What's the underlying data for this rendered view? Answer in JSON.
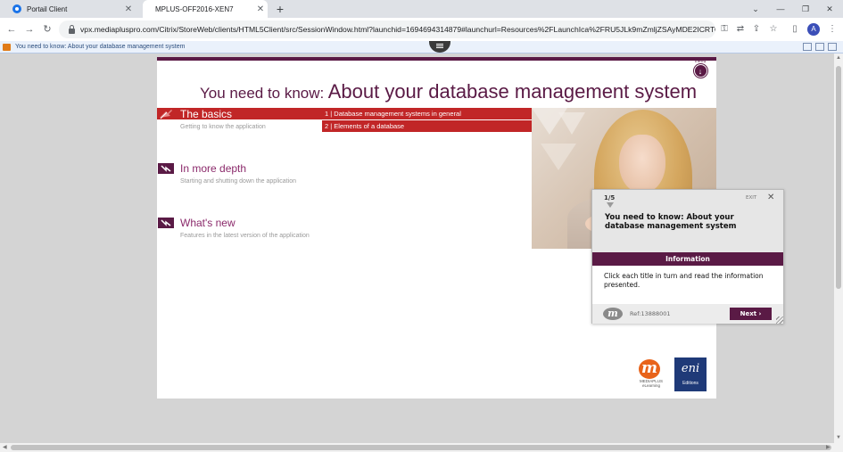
{
  "browser": {
    "tabs": [
      {
        "title": "Portail Client",
        "active": false
      },
      {
        "title": "MPLUS-OFF2016-XEN7",
        "active": true
      }
    ],
    "url": "vpx.mediapluspro.com/Citrix/StoreWeb/clients/HTML5Client/src/SessionWindow.html?launchid=1694694314879#launchurl=Resources%2FLaunchIca%2FRU5JLk9mZmljZSAyMDE2ICRTO...",
    "avatar_letter": "A",
    "icons": [
      "back-icon",
      "forward-icon",
      "reload-icon",
      "lock-icon",
      "key-icon",
      "translate-icon",
      "share-icon",
      "star-icon",
      "side-panel-icon",
      "more-icon"
    ]
  },
  "infobar": {
    "text": "You need to know: About your database management system"
  },
  "slide": {
    "menu_label": "menu",
    "title_prefix": "You need to know:",
    "title_main": "About your database management system",
    "sections": [
      {
        "title": "The basics",
        "subtitle": "Getting to know the application",
        "active": true
      },
      {
        "title": "In more depth",
        "subtitle": "Starting and shutting down the application",
        "active": false
      },
      {
        "title": "What's new",
        "subtitle": "Features in the latest version of the application",
        "active": false
      }
    ],
    "sub_links": [
      "1 | Database management systems in general",
      "2 | Elements of a database"
    ],
    "logos": {
      "mediaplus_letter": "m",
      "mediaplus_text": "MEDIAPLUS eLearning",
      "eni_letter": "eni",
      "eni_text": "Editions"
    },
    "colors": {
      "accent_red": "#c12627",
      "plum": "#5a1a45",
      "section_plum": "#8b2a6b",
      "section_active": "#ffffff"
    }
  },
  "guide": {
    "step": "1/5",
    "exit": "EXIT",
    "title": "You need to know: About your database management system",
    "info_header": "Information",
    "message": "Click each title in turn and read the information presented.",
    "ref": "Ref:13888001",
    "next_label": "Next"
  }
}
